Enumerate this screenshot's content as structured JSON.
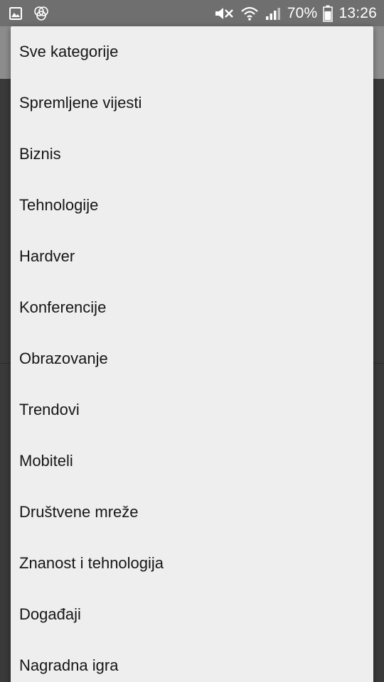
{
  "status_bar": {
    "icons_left": [
      "image-icon",
      "triple-circle-icon"
    ],
    "icons_right": [
      "mute-icon",
      "wifi-icon",
      "signal-icon"
    ],
    "battery_percent": "70%",
    "battery_level": 0.7,
    "time": "13:26"
  },
  "menu": {
    "items": [
      {
        "label": "Sve kategorije"
      },
      {
        "label": "Spremljene vijesti"
      },
      {
        "label": "Biznis"
      },
      {
        "label": "Tehnologije"
      },
      {
        "label": "Hardver"
      },
      {
        "label": "Konferencije"
      },
      {
        "label": "Obrazovanje"
      },
      {
        "label": "Trendovi"
      },
      {
        "label": "Mobiteli"
      },
      {
        "label": "Društvene mreže"
      },
      {
        "label": "Znanost i tehnologija"
      },
      {
        "label": "Događaji"
      },
      {
        "label": "Nagradna igra"
      }
    ]
  },
  "colors": {
    "status_bar_bg": "#6f6f6f",
    "menu_bg": "#eeeeee",
    "menu_text": "#161616",
    "dim_background": "#3a3a3a"
  }
}
